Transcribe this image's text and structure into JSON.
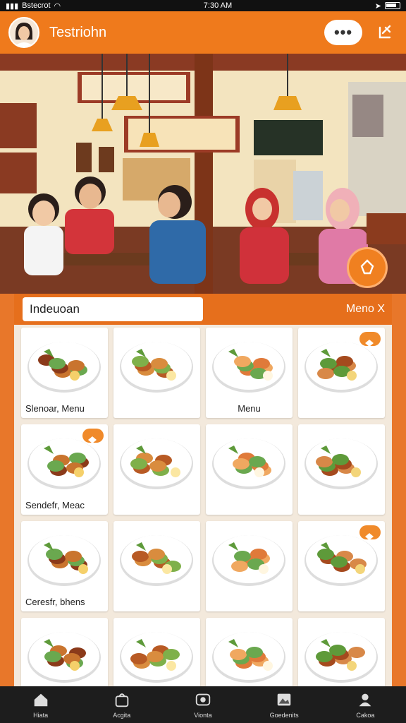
{
  "status_bar": {
    "carrier": "Bstecrot",
    "time": "7:30 AM"
  },
  "header": {
    "title": "Testriohn",
    "more_label": "•••"
  },
  "menu": {
    "search_value": "Indeuoan",
    "menu_link": "Meno X",
    "tiles": [
      {
        "label": "Slenoar, Menu",
        "align": "left",
        "badge": false
      },
      {
        "label": "",
        "align": "left",
        "badge": false
      },
      {
        "label": "Menu",
        "align": "center",
        "badge": false
      },
      {
        "label": "",
        "align": "left",
        "badge": true
      },
      {
        "label": "Sendefr, Meac",
        "align": "left",
        "badge": true
      },
      {
        "label": "",
        "align": "left",
        "badge": false
      },
      {
        "label": "",
        "align": "left",
        "badge": false
      },
      {
        "label": "",
        "align": "left",
        "badge": false
      },
      {
        "label": "Ceresfr, bhens",
        "align": "left",
        "badge": false
      },
      {
        "label": "",
        "align": "left",
        "badge": false
      },
      {
        "label": "",
        "align": "left",
        "badge": false
      },
      {
        "label": "",
        "align": "left",
        "badge": true
      },
      {
        "label": "",
        "align": "left",
        "badge": false
      },
      {
        "label": "",
        "align": "left",
        "badge": false
      },
      {
        "label": "",
        "align": "left",
        "badge": false
      },
      {
        "label": "",
        "align": "left",
        "badge": false
      }
    ]
  },
  "nav": [
    {
      "label": "Hiata",
      "icon": "home-icon"
    },
    {
      "label": "Acgita",
      "icon": "bag-icon"
    },
    {
      "label": "Vionta",
      "icon": "camera-icon"
    },
    {
      "label": "Goedenits",
      "icon": "gallery-icon"
    },
    {
      "label": "Cakoa",
      "icon": "profile-icon"
    }
  ]
}
